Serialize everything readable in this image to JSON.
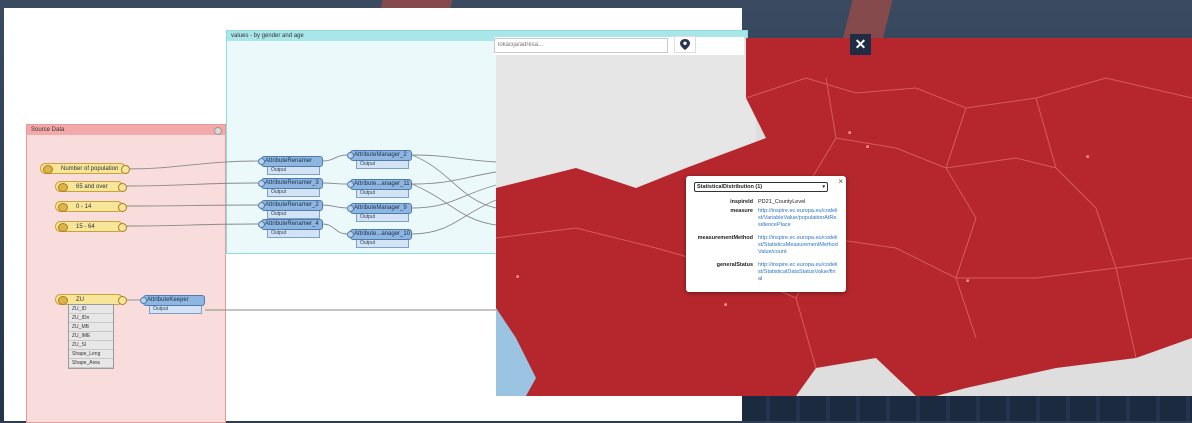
{
  "workbench": {
    "source_bookmark": "Source Data",
    "values_bookmark": "values - by gender and age",
    "readers": [
      "Number of population",
      "65 and over",
      "0 - 14",
      "15 - 64",
      "ZU"
    ],
    "transformers": [
      {
        "name": "AttributeRenamer",
        "port": "Output"
      },
      {
        "name": "AttributeRenamer_3",
        "port": "Output"
      },
      {
        "name": "AttributeRenamer_2",
        "port": "Output"
      },
      {
        "name": "AttributeRenamer_4",
        "port": "Output"
      },
      {
        "name": "AttributeManager_2",
        "port": "Output"
      },
      {
        "name": "Attribute...anager_11",
        "port": "Output"
      },
      {
        "name": "AttributeManager_9",
        "port": "Output"
      },
      {
        "name": "Attribute...anager_10",
        "port": "Output"
      },
      {
        "name": "AttributeKeeper",
        "port": "Output"
      }
    ],
    "zu_attributes": [
      "ZU_ID",
      "ZU_IDn",
      "ZU_MB",
      "ZU_IME",
      "ZU_SI",
      "Shape_Leng",
      "Shape_Area"
    ]
  },
  "map": {
    "search_placeholder": "lokacija/adresa...",
    "close_label": "✕",
    "popup": {
      "selector": "StatisticalDistribution (1)",
      "close": "×",
      "rows": [
        {
          "key": "inspireId",
          "value": "PD21_CountyLevel",
          "link": false
        },
        {
          "key": "measure",
          "value": "http://inspire.ec.europa.eu/codelist/VariableValue/populationAtResidencePlace",
          "link": true
        },
        {
          "key": "measurementMethod",
          "value": "http://inspire.ec.europa.eu/codelist/StatisticsMeasurementMethodValue/count",
          "link": true
        },
        {
          "key": "generalStatus",
          "value": "http://inspire.ec.europa.eu/codelist/StatisticalDataStatusValue/final",
          "link": true
        }
      ]
    },
    "colors": {
      "fill": "#b5272c",
      "border": "#d85a5f",
      "outside": "#dedede",
      "sea": "#9ac4e2"
    }
  }
}
